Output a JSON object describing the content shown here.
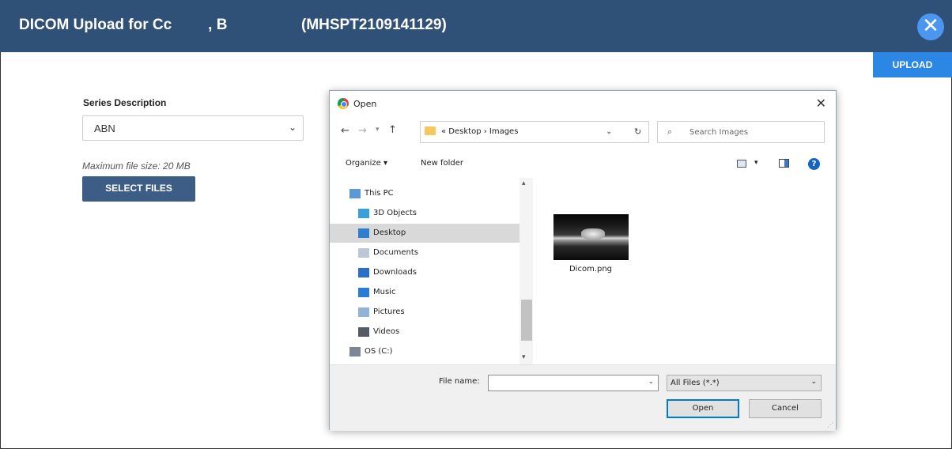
{
  "header": {
    "title_prefix": "DICOM Upload for Cc",
    "title_suffix": ", B",
    "patient_id": "(MHSPT2109141129)",
    "close_icon": "close-icon"
  },
  "toolbar": {
    "upload_label": "UPLOAD"
  },
  "form": {
    "series_label": "Series Description",
    "series_value": "ABN",
    "max_size_text": "Maximum file size: 20 MB",
    "select_files_label": "SELECT FILES"
  },
  "dialog": {
    "title": "Open",
    "breadcrumb": "« Desktop › Images",
    "search_placeholder": "Search Images",
    "organize_label": "Organize ▾",
    "new_folder_label": "New folder",
    "nav_items": [
      {
        "label": "This PC",
        "icon": "computer-icon",
        "color": "#5b9bd5"
      },
      {
        "label": "3D Objects",
        "icon": "cube-icon",
        "color": "#3aa0d9"
      },
      {
        "label": "Desktop",
        "icon": "desktop-icon",
        "color": "#2e7fd1",
        "selected": true
      },
      {
        "label": "Documents",
        "icon": "document-icon",
        "color": "#bcc8d6"
      },
      {
        "label": "Downloads",
        "icon": "download-icon",
        "color": "#2b6fcc"
      },
      {
        "label": "Music",
        "icon": "music-icon",
        "color": "#2b7bd8"
      },
      {
        "label": "Pictures",
        "icon": "pictures-icon",
        "color": "#8fb3d9"
      },
      {
        "label": "Videos",
        "icon": "video-icon",
        "color": "#555c66"
      },
      {
        "label": "OS (C:)",
        "icon": "drive-icon",
        "color": "#7d8794"
      }
    ],
    "file": {
      "name": "Dicom.png"
    },
    "filename_label": "File name:",
    "filename_value": "",
    "filetype_value": "All Files (*.*)",
    "open_label": "Open",
    "cancel_label": "Cancel"
  }
}
